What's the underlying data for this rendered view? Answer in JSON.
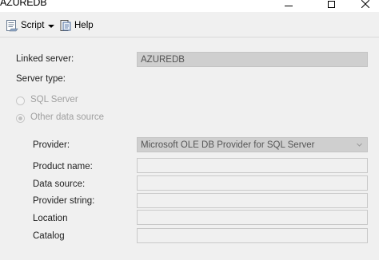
{
  "window": {
    "title": "AZUREDB"
  },
  "toolbar": {
    "script_label": "Script",
    "help_label": "Help"
  },
  "form": {
    "linked_server_label": "Linked server:",
    "linked_server_value": "AZUREDB",
    "server_type_label": "Server type:",
    "radio_sql_server": "SQL Server",
    "radio_other": "Other data source",
    "provider_label": "Provider:",
    "provider_value": "Microsoft OLE DB Provider for SQL Server",
    "product_name_label": "Product name:",
    "data_source_label": "Data source:",
    "provider_string_label": "Provider string:",
    "location_label": "Location",
    "catalog_label": "Catalog"
  }
}
